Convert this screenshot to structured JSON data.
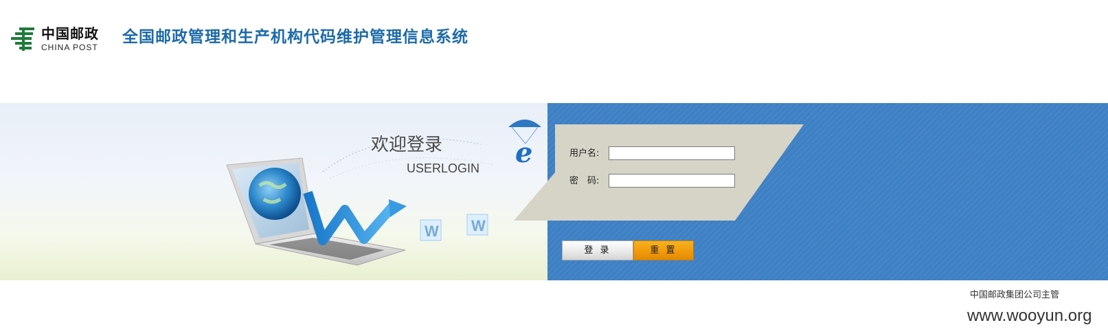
{
  "header": {
    "logo": {
      "name_cn": "中国邮政",
      "name_en": "CHINA POST"
    },
    "system_title": "全国邮政管理和生产机构代码维护管理信息系统"
  },
  "banner": {
    "welcome_title": "欢迎登录",
    "welcome_subtitle": "USERLOGIN",
    "illustration_letters": [
      "W",
      "W",
      "e"
    ]
  },
  "login_form": {
    "username_label": "用户名:",
    "username_value": "",
    "password_label": "密　码:",
    "password_value": "",
    "login_button": "登 录",
    "reset_button": "重 置"
  },
  "footer": {
    "org_text": "中国邮政集团公司主管",
    "watermark": "www.wooyun.org"
  },
  "colors": {
    "title_blue": "#1d6aa8",
    "panel_blue": "#3d80c4",
    "panel_grey": "#d6d4c7",
    "logo_green": "#1f7a3a",
    "reset_orange": "#f19a0c"
  },
  "icons": [
    "china-post-emblem-icon",
    "laptop-globe-illustration",
    "parachute-e-icon",
    "w-cube-icon"
  ]
}
